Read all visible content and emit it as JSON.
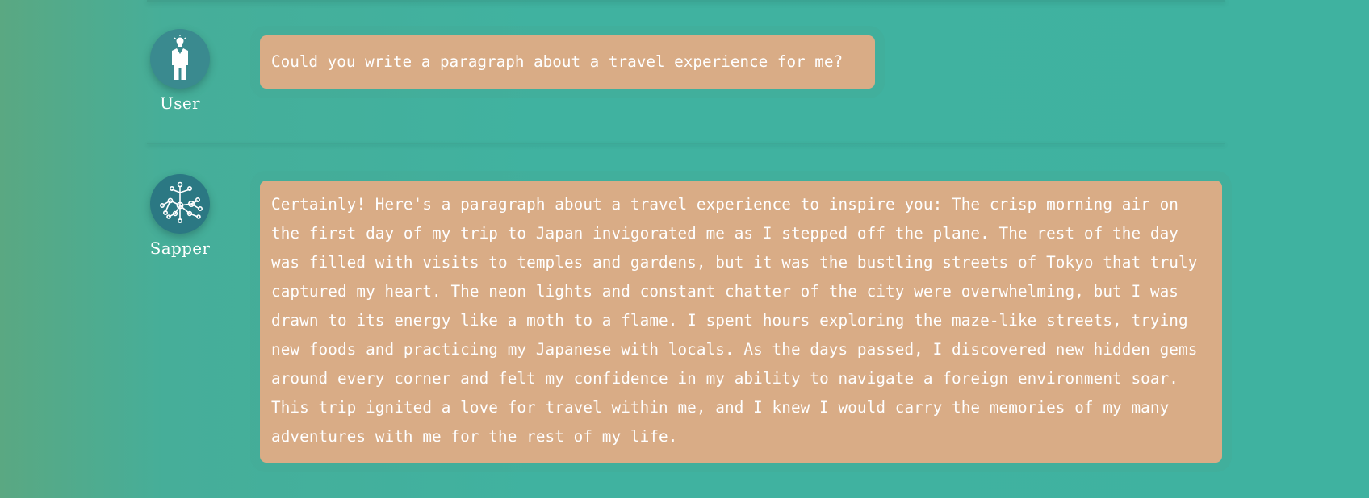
{
  "conversation": {
    "messages": [
      {
        "role": "user",
        "author": "User",
        "avatar_icon": "user-person-icon",
        "text": "Could you write a paragraph about a travel experience for me?"
      },
      {
        "role": "assistant",
        "author": "Sapper",
        "avatar_icon": "network-nodes-icon",
        "text": "Certainly! Here's a paragraph about a travel experience to inspire you: The crisp morning air on the first day of my trip to Japan invigorated me as I stepped off the plane. The rest of the day was filled with visits to temples and gardens, but it was the bustling streets of Tokyo that truly captured my heart. The neon lights and constant chatter of the city were overwhelming, but I was drawn to its energy like a moth to a flame. I spent hours exploring the maze-like streets, trying new foods and practicing my Japanese with locals. As the days passed, I discovered new hidden gems around every corner and felt my confidence in my ability to navigate a foreign environment soar. This trip ignited a love for travel within me, and I knew I would carry the memories of my many adventures with me for the rest of my life."
      }
    ]
  },
  "colors": {
    "background": "#40b2a0",
    "bubble": "#d9ac86",
    "user_avatar": "#3a8a8f",
    "bot_avatar": "#2b7883",
    "text": "#ffffff"
  }
}
